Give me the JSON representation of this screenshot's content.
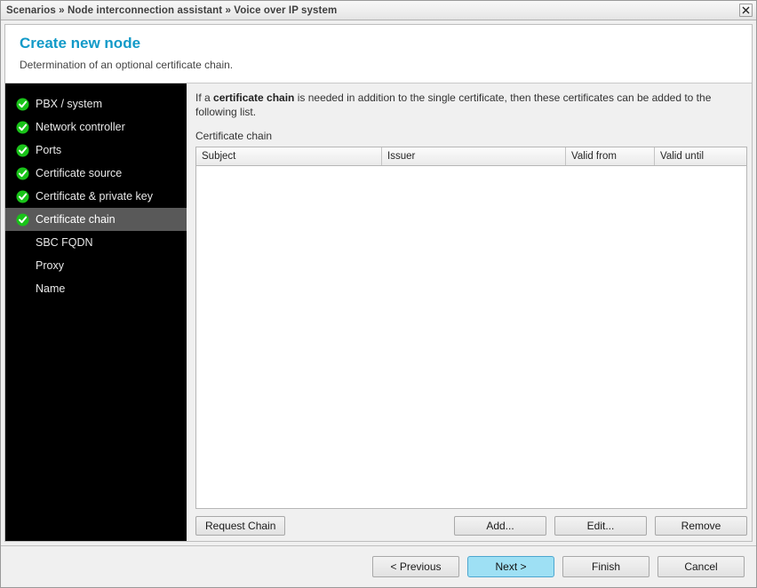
{
  "titlebar": {
    "breadcrumb": "Scenarios » Node interconnection assistant » Voice over IP system",
    "close_label": "×"
  },
  "header": {
    "title": "Create new node",
    "subtitle": "Determination of an optional certificate chain.",
    "title_color": "#129ac8"
  },
  "sidebar": {
    "background": "#000000",
    "current_background": "#595959",
    "check_color": "#19c319",
    "items": [
      {
        "label": "PBX / system",
        "state": "done",
        "icon": "check-circle-icon"
      },
      {
        "label": "Network controller",
        "state": "done",
        "icon": "check-circle-icon"
      },
      {
        "label": "Ports",
        "state": "done",
        "icon": "check-circle-icon"
      },
      {
        "label": "Certificate source",
        "state": "done",
        "icon": "check-circle-icon"
      },
      {
        "label": "Certificate & private key",
        "state": "done",
        "icon": "check-circle-icon"
      },
      {
        "label": "Certificate chain",
        "state": "current",
        "icon": "check-circle-icon"
      },
      {
        "label": "SBC FQDN",
        "state": "pending",
        "icon": ""
      },
      {
        "label": "Proxy",
        "state": "pending",
        "icon": ""
      },
      {
        "label": "Name",
        "state": "pending",
        "icon": ""
      }
    ]
  },
  "content": {
    "intro_prefix": "If a ",
    "intro_bold": "certificate chain",
    "intro_suffix": " is needed in addition to the single certificate, then these certificates can be added to the following list.",
    "group_label": "Certificate chain",
    "table": {
      "columns": [
        "Subject",
        "Issuer",
        "Valid from",
        "Valid until"
      ],
      "rows": []
    },
    "actions": {
      "request_chain": "Request Chain",
      "add": "Add...",
      "edit": "Edit...",
      "remove": "Remove"
    }
  },
  "footer": {
    "previous": "< Previous",
    "next": "Next >",
    "finish": "Finish",
    "cancel": "Cancel",
    "next_highlight_color": "#9ee0f4"
  }
}
